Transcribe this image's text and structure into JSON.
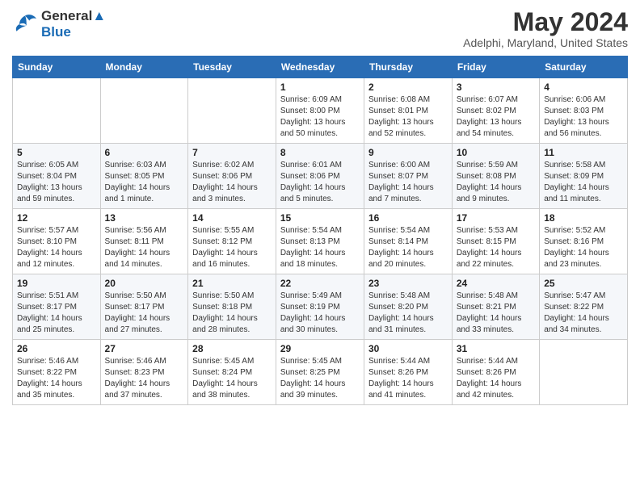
{
  "logo": {
    "line1": "General",
    "line2": "Blue"
  },
  "title": "May 2024",
  "subtitle": "Adelphi, Maryland, United States",
  "weekdays": [
    "Sunday",
    "Monday",
    "Tuesday",
    "Wednesday",
    "Thursday",
    "Friday",
    "Saturday"
  ],
  "weeks": [
    [
      {
        "day": "",
        "info": ""
      },
      {
        "day": "",
        "info": ""
      },
      {
        "day": "",
        "info": ""
      },
      {
        "day": "1",
        "info": "Sunrise: 6:09 AM\nSunset: 8:00 PM\nDaylight: 13 hours\nand 50 minutes."
      },
      {
        "day": "2",
        "info": "Sunrise: 6:08 AM\nSunset: 8:01 PM\nDaylight: 13 hours\nand 52 minutes."
      },
      {
        "day": "3",
        "info": "Sunrise: 6:07 AM\nSunset: 8:02 PM\nDaylight: 13 hours\nand 54 minutes."
      },
      {
        "day": "4",
        "info": "Sunrise: 6:06 AM\nSunset: 8:03 PM\nDaylight: 13 hours\nand 56 minutes."
      }
    ],
    [
      {
        "day": "5",
        "info": "Sunrise: 6:05 AM\nSunset: 8:04 PM\nDaylight: 13 hours\nand 59 minutes."
      },
      {
        "day": "6",
        "info": "Sunrise: 6:03 AM\nSunset: 8:05 PM\nDaylight: 14 hours\nand 1 minute."
      },
      {
        "day": "7",
        "info": "Sunrise: 6:02 AM\nSunset: 8:06 PM\nDaylight: 14 hours\nand 3 minutes."
      },
      {
        "day": "8",
        "info": "Sunrise: 6:01 AM\nSunset: 8:06 PM\nDaylight: 14 hours\nand 5 minutes."
      },
      {
        "day": "9",
        "info": "Sunrise: 6:00 AM\nSunset: 8:07 PM\nDaylight: 14 hours\nand 7 minutes."
      },
      {
        "day": "10",
        "info": "Sunrise: 5:59 AM\nSunset: 8:08 PM\nDaylight: 14 hours\nand 9 minutes."
      },
      {
        "day": "11",
        "info": "Sunrise: 5:58 AM\nSunset: 8:09 PM\nDaylight: 14 hours\nand 11 minutes."
      }
    ],
    [
      {
        "day": "12",
        "info": "Sunrise: 5:57 AM\nSunset: 8:10 PM\nDaylight: 14 hours\nand 12 minutes."
      },
      {
        "day": "13",
        "info": "Sunrise: 5:56 AM\nSunset: 8:11 PM\nDaylight: 14 hours\nand 14 minutes."
      },
      {
        "day": "14",
        "info": "Sunrise: 5:55 AM\nSunset: 8:12 PM\nDaylight: 14 hours\nand 16 minutes."
      },
      {
        "day": "15",
        "info": "Sunrise: 5:54 AM\nSunset: 8:13 PM\nDaylight: 14 hours\nand 18 minutes."
      },
      {
        "day": "16",
        "info": "Sunrise: 5:54 AM\nSunset: 8:14 PM\nDaylight: 14 hours\nand 20 minutes."
      },
      {
        "day": "17",
        "info": "Sunrise: 5:53 AM\nSunset: 8:15 PM\nDaylight: 14 hours\nand 22 minutes."
      },
      {
        "day": "18",
        "info": "Sunrise: 5:52 AM\nSunset: 8:16 PM\nDaylight: 14 hours\nand 23 minutes."
      }
    ],
    [
      {
        "day": "19",
        "info": "Sunrise: 5:51 AM\nSunset: 8:17 PM\nDaylight: 14 hours\nand 25 minutes."
      },
      {
        "day": "20",
        "info": "Sunrise: 5:50 AM\nSunset: 8:17 PM\nDaylight: 14 hours\nand 27 minutes."
      },
      {
        "day": "21",
        "info": "Sunrise: 5:50 AM\nSunset: 8:18 PM\nDaylight: 14 hours\nand 28 minutes."
      },
      {
        "day": "22",
        "info": "Sunrise: 5:49 AM\nSunset: 8:19 PM\nDaylight: 14 hours\nand 30 minutes."
      },
      {
        "day": "23",
        "info": "Sunrise: 5:48 AM\nSunset: 8:20 PM\nDaylight: 14 hours\nand 31 minutes."
      },
      {
        "day": "24",
        "info": "Sunrise: 5:48 AM\nSunset: 8:21 PM\nDaylight: 14 hours\nand 33 minutes."
      },
      {
        "day": "25",
        "info": "Sunrise: 5:47 AM\nSunset: 8:22 PM\nDaylight: 14 hours\nand 34 minutes."
      }
    ],
    [
      {
        "day": "26",
        "info": "Sunrise: 5:46 AM\nSunset: 8:22 PM\nDaylight: 14 hours\nand 35 minutes."
      },
      {
        "day": "27",
        "info": "Sunrise: 5:46 AM\nSunset: 8:23 PM\nDaylight: 14 hours\nand 37 minutes."
      },
      {
        "day": "28",
        "info": "Sunrise: 5:45 AM\nSunset: 8:24 PM\nDaylight: 14 hours\nand 38 minutes."
      },
      {
        "day": "29",
        "info": "Sunrise: 5:45 AM\nSunset: 8:25 PM\nDaylight: 14 hours\nand 39 minutes."
      },
      {
        "day": "30",
        "info": "Sunrise: 5:44 AM\nSunset: 8:26 PM\nDaylight: 14 hours\nand 41 minutes."
      },
      {
        "day": "31",
        "info": "Sunrise: 5:44 AM\nSunset: 8:26 PM\nDaylight: 14 hours\nand 42 minutes."
      },
      {
        "day": "",
        "info": ""
      }
    ]
  ]
}
